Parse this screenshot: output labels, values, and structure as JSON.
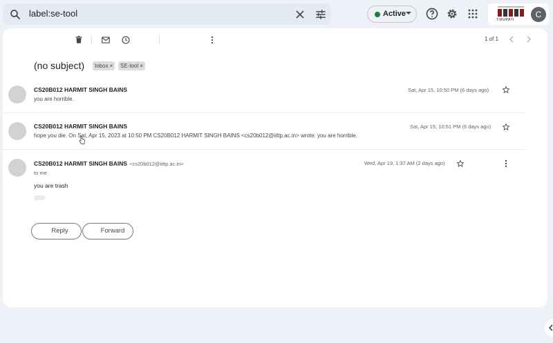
{
  "search": {
    "query": "label:se-tool"
  },
  "status": {
    "label": "Active",
    "color": "#188038"
  },
  "account": {
    "avatar_letter": "C",
    "logo_text": "TIRUPATI"
  },
  "pager": {
    "text": "1 of 1"
  },
  "thread": {
    "subject": "(no subject)",
    "labels": [
      "Inbox",
      "SE-tool"
    ],
    "messages": [
      {
        "sender": "CS20B012 HARMIT SINGH BAINS",
        "snippet": "you are horrible.",
        "date": "Sat, Apr 15, 10:50 PM (6 days ago)"
      },
      {
        "sender": "CS20B012 HARMIT SINGH BAINS",
        "snippet": "hope you die. On Sat, Apr 15, 2023 at 10:50 PM CS20B012 HARMIT SINGH BAINS <cs20b012@iittp.ac.in> wrote: you are horrible.",
        "date": "Sat, Apr 15, 10:51 PM (6 days ago)"
      },
      {
        "sender": "CS20B012 HARMIT SINGH BAINS",
        "email": "<cs20b012@iittp.ac.in>",
        "to": "to me",
        "body": "you are trash",
        "date": "Wed, Apr 19, 1:37 AM (2 days ago)"
      }
    ]
  },
  "actions": {
    "reply": "Reply",
    "forward": "Forward"
  }
}
